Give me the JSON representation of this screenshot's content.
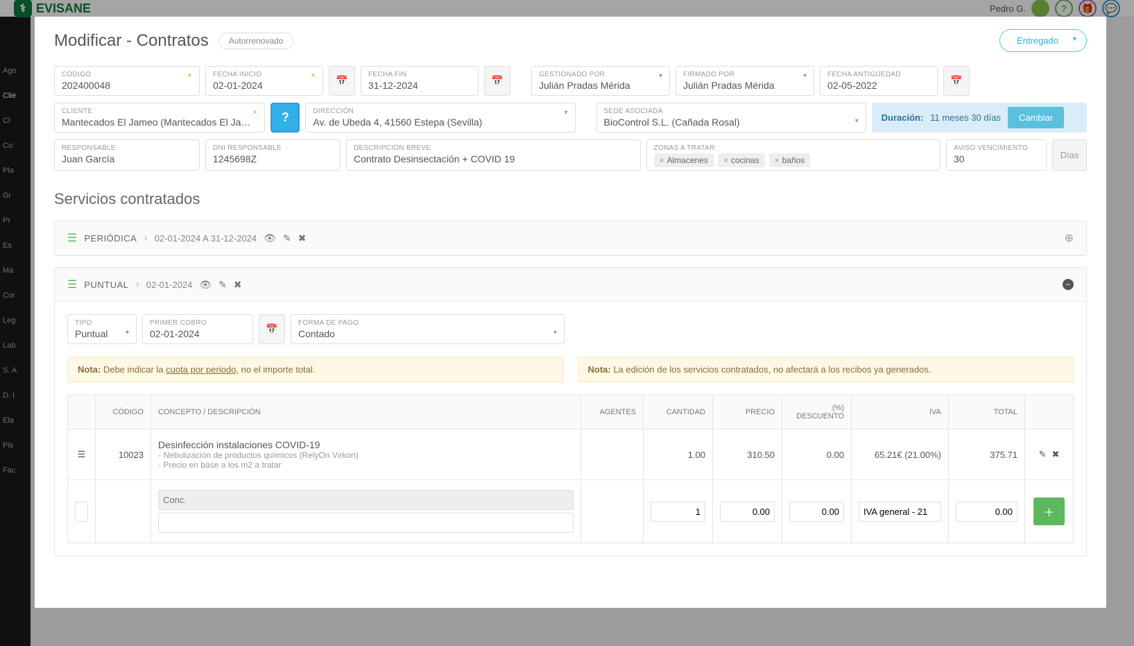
{
  "topbar": {
    "logo": "EVISANE",
    "user": "Pedro G."
  },
  "sidebar": [
    {
      "label": "Age",
      "active": false
    },
    {
      "label": "Clie",
      "active": true
    },
    {
      "label": "Cl",
      "active": false
    },
    {
      "label": "Co",
      "active": false
    },
    {
      "label": "Pla",
      "active": false
    },
    {
      "label": "Gr",
      "active": false
    },
    {
      "label": "Pr",
      "active": false
    },
    {
      "label": "Es",
      "active": false
    },
    {
      "label": "Ma",
      "active": false
    },
    {
      "label": "Cor",
      "active": false
    },
    {
      "label": "Leg",
      "active": false
    },
    {
      "label": "Lab",
      "active": false
    },
    {
      "label": "S. A",
      "active": false
    },
    {
      "label": "D. I",
      "active": false
    },
    {
      "label": "Ela",
      "active": false
    },
    {
      "label": "Pis",
      "active": false
    },
    {
      "label": "Fac",
      "active": false
    }
  ],
  "modal": {
    "title": "Modificar - Contratos",
    "pill": "Autorrenovado",
    "status": "Entregado"
  },
  "fields": {
    "codigo_label": "CÓDIGO",
    "codigo": "202400048",
    "fecha_inicio_label": "FECHA INICIO",
    "fecha_inicio": "02-01-2024",
    "fecha_fin_label": "FECHA FIN",
    "fecha_fin": "31-12-2024",
    "gestionado_label": "GESTIONADO POR",
    "gestionado": "Julián Pradas Mérida",
    "firmado_label": "FIRMADO POR",
    "firmado": "Julián Pradas Mérida",
    "antiguedad_label": "FECHA ANTIGÜEDAD",
    "antiguedad": "02-05-2022",
    "cliente_label": "CLIENTE",
    "cliente": "Mantecados El Jameo (Mantecados El Jame...",
    "direccion_label": "DIRECCIÓN",
    "direccion": "Av. de Ubeda 4, 41560 Estepa (Sevilla)",
    "sede_label": "SEDE ASOCIADA",
    "sede": "BioControl S.L. (Cañada Rosal)",
    "duracion_label": "Duración:",
    "duracion": "11 meses 30 días",
    "cambiar": "Cambiar",
    "responsable_label": "RESPONSABLE",
    "responsable": "Juan García",
    "dni_label": "DNI RESPONSABLE",
    "dni": "1245698Z",
    "descripcion_label": "DESCRIPCIÓN BREVE",
    "descripcion": "Contrato Desinsectación + COVID 19",
    "zonas_label": "ZONAS A TRATAR",
    "zonas": [
      "Almacenes",
      "cocinas",
      "baños"
    ],
    "aviso_label": "AVISO VENCIMIENTO",
    "aviso": "30",
    "dias": "Días"
  },
  "section_title": "Servicios contratados",
  "periodica": {
    "label": "PERIÓDICA",
    "dates": "02-01-2024 A 31-12-2024"
  },
  "puntual": {
    "label": "PUNTUAL",
    "dates": "02-01-2024",
    "tipo_label": "TIPO",
    "tipo": "Puntual",
    "primer_label": "PRIMER COBRO",
    "primer": "02-01-2024",
    "forma_label": "FORMA DE PAGO",
    "forma": "Contado",
    "note1_prefix": "Nota:",
    "note1_a": " Debe indicar la ",
    "note1_u": "cuota por periodo",
    "note1_b": ", no el importe total.",
    "note2_prefix": "Nota:",
    "note2": " La edición de los servicios contratados, no afectará a los recibos ya generados.",
    "headers": {
      "codigo": "CÓDIGO",
      "concepto": "CONCEPTO / DESCRIPCIÓN",
      "agentes": "AGENTES",
      "cantidad": "CANTIDAD",
      "precio": "PRECIO",
      "descuento_pct": "(%)",
      "descuento": "DESCUENTO",
      "iva": "IVA",
      "total": "TOTAL"
    },
    "row": {
      "codigo": "10023",
      "concepto": "Desinfección instalaciones COVID-19",
      "sub1": "- Nebulización de productos químicos (RelyOn Virkon)",
      "sub2": "- Precio en base a los m2 a tratar",
      "cantidad": "1.00",
      "precio": "310.50",
      "descuento": "0.00",
      "iva": "65.21€ (21.00%)",
      "total": "375.71"
    },
    "input_row": {
      "concepto_ph": "Conc.",
      "cantidad": "1",
      "precio": "0.00",
      "descuento": "0.00",
      "iva": "IVA general - 21",
      "total": "0.00"
    }
  }
}
